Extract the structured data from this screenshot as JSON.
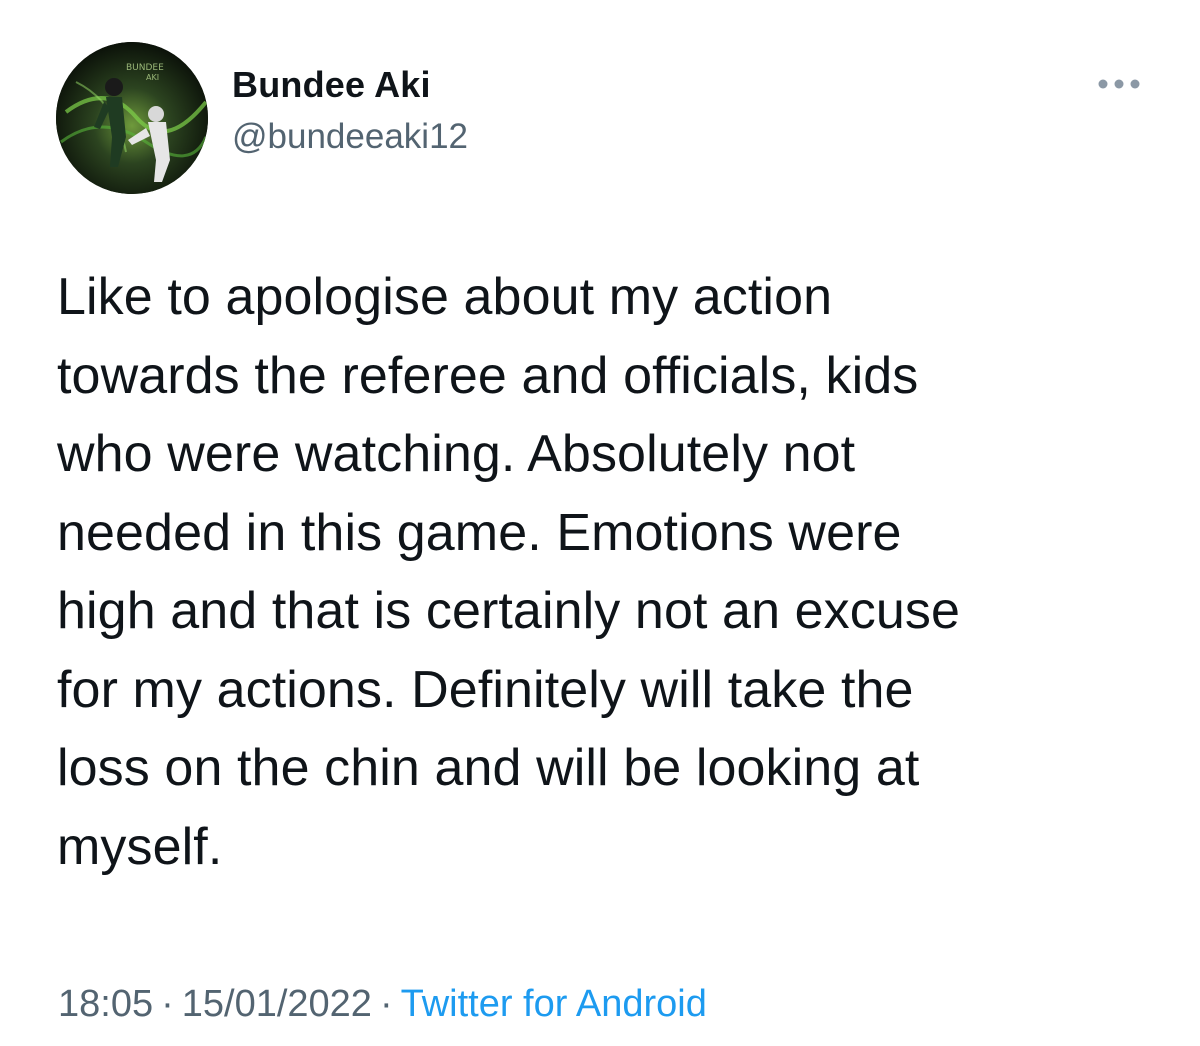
{
  "user": {
    "display_name": "Bundee Aki",
    "handle": "@bundeeaki12",
    "avatar_icon": "profile-photo"
  },
  "menu": {
    "icon": "more-dots-icon"
  },
  "tweet": {
    "lines": [
      "Like to apologise about my action",
      "towards the referee and officials, kids",
      "who were watching. Absolutely not",
      "needed in this game. Emotions were",
      "high and that is certainly not an excuse",
      "for my actions. Definitely will take the",
      "loss on the chin and will be looking at",
      "myself."
    ]
  },
  "meta": {
    "time": "18:05",
    "separator": "·",
    "date": "15/01/2022",
    "source": "Twitter for Android"
  },
  "colors": {
    "text": "#0f1419",
    "secondary": "#536471",
    "link": "#1d9bf0"
  }
}
